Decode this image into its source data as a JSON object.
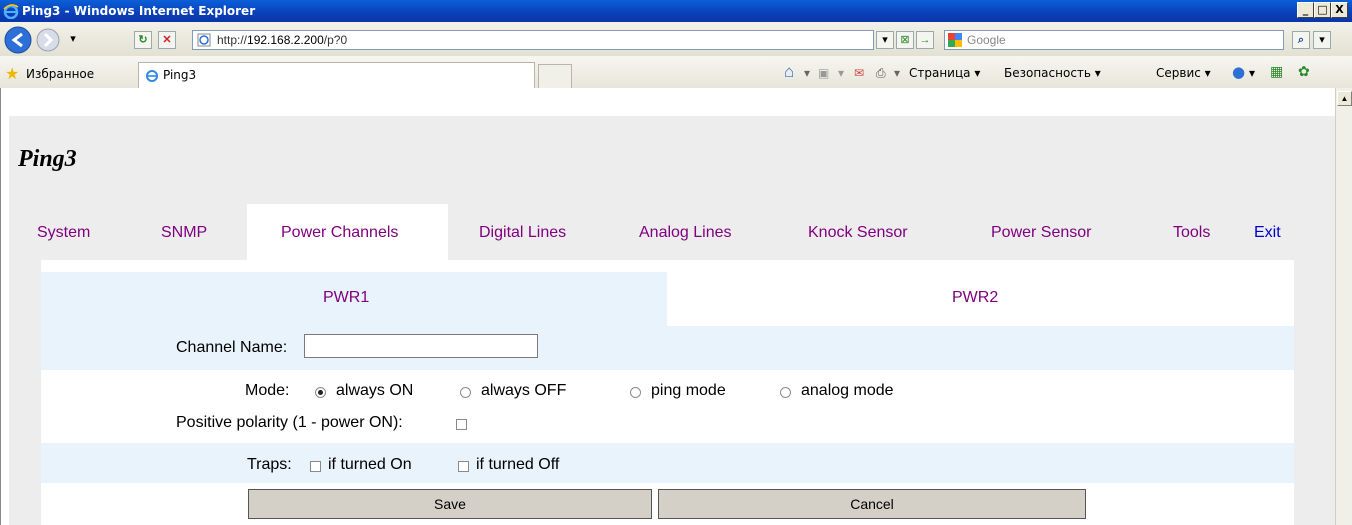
{
  "window": {
    "title": "Ping3 - Windows Internet Explorer",
    "min_glyph": "_",
    "max_glyph": "□",
    "close_glyph": "X"
  },
  "address": {
    "prefix": "http://",
    "host": "192.168.2.200",
    "path": "/p?0"
  },
  "search": {
    "placeholder": "Google"
  },
  "favorites": {
    "label": "Избранное",
    "tab_title": "Ping3"
  },
  "command_bar": {
    "page": "Страница ▾",
    "safety": "Безопасность ▾",
    "tools": "Сервис ▾"
  },
  "page": {
    "heading": "Ping3",
    "nav": [
      "System",
      "SNMP",
      "Power Channels",
      "Digital Lines",
      "Analog Lines",
      "Knock Sensor",
      "Power Sensor",
      "Tools",
      "Exit"
    ],
    "subtabs": [
      "PWR1",
      "PWR2"
    ],
    "channel_name_label": "Channel Name:",
    "channel_name_value": "",
    "mode_label": "Mode:",
    "modes": [
      "always ON",
      "always OFF",
      "ping mode",
      "analog mode"
    ],
    "mode_selected": "always ON",
    "polarity_label": "Positive polarity (1 - power ON):",
    "traps_label": "Traps:",
    "traps": [
      "if turned On",
      "if turned Off"
    ],
    "save": "Save",
    "cancel": "Cancel"
  },
  "colors": {
    "link": "#800080",
    "exit_link": "#0000cc",
    "row_shade": "#e8f3fc"
  }
}
